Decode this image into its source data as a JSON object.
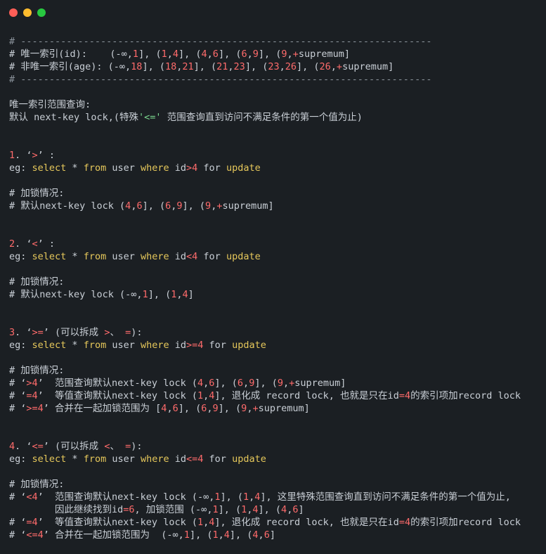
{
  "window": {
    "controls": [
      {
        "name": "close",
        "color": "#ff5f57"
      },
      {
        "name": "minimize",
        "color": "#febc2e"
      },
      {
        "name": "zoom",
        "color": "#28c840"
      }
    ]
  },
  "lines": [
    {
      "segs": [
        {
          "t": "# ------------------------------------------------------------------------",
          "c": "dim"
        }
      ]
    },
    {
      "segs": [
        {
          "t": "# 唯一索引(id):    (-∞,",
          "c": "cm"
        },
        {
          "t": "1",
          "c": "num"
        },
        {
          "t": "], (",
          "c": "cm"
        },
        {
          "t": "1",
          "c": "num"
        },
        {
          "t": ",",
          "c": "cm"
        },
        {
          "t": "4",
          "c": "num"
        },
        {
          "t": "], (",
          "c": "cm"
        },
        {
          "t": "4",
          "c": "num"
        },
        {
          "t": ",",
          "c": "cm"
        },
        {
          "t": "6",
          "c": "num"
        },
        {
          "t": "], (",
          "c": "cm"
        },
        {
          "t": "6",
          "c": "num"
        },
        {
          "t": ",",
          "c": "cm"
        },
        {
          "t": "9",
          "c": "num"
        },
        {
          "t": "], (",
          "c": "cm"
        },
        {
          "t": "9",
          "c": "num"
        },
        {
          "t": ",",
          "c": "cm"
        },
        {
          "t": "+",
          "c": "op"
        },
        {
          "t": "supremum]",
          "c": "cm"
        }
      ]
    },
    {
      "segs": [
        {
          "t": "# 非唯一索引(age): (-∞,",
          "c": "cm"
        },
        {
          "t": "18",
          "c": "num"
        },
        {
          "t": "], (",
          "c": "cm"
        },
        {
          "t": "18",
          "c": "num"
        },
        {
          "t": ",",
          "c": "cm"
        },
        {
          "t": "21",
          "c": "num"
        },
        {
          "t": "], (",
          "c": "cm"
        },
        {
          "t": "21",
          "c": "num"
        },
        {
          "t": ",",
          "c": "cm"
        },
        {
          "t": "23",
          "c": "num"
        },
        {
          "t": "], (",
          "c": "cm"
        },
        {
          "t": "23",
          "c": "num"
        },
        {
          "t": ",",
          "c": "cm"
        },
        {
          "t": "26",
          "c": "num"
        },
        {
          "t": "], (",
          "c": "cm"
        },
        {
          "t": "26",
          "c": "num"
        },
        {
          "t": ",",
          "c": "cm"
        },
        {
          "t": "+",
          "c": "op"
        },
        {
          "t": "supremum]",
          "c": "cm"
        }
      ]
    },
    {
      "segs": [
        {
          "t": "# ------------------------------------------------------------------------",
          "c": "dim"
        }
      ]
    },
    {
      "segs": []
    },
    {
      "segs": [
        {
          "t": "唯一索引范围查询:",
          "c": "cm"
        }
      ]
    },
    {
      "segs": [
        {
          "t": "默认 next-key lock,(特殊",
          "c": "cm"
        },
        {
          "t": "'<='",
          "c": "str"
        },
        {
          "t": " 范围查询直到访问不满足条件的第一个值为止)",
          "c": "cm"
        }
      ]
    },
    {
      "segs": []
    },
    {
      "segs": []
    },
    {
      "segs": [
        {
          "t": "1",
          "c": "num"
        },
        {
          "t": ". ‘",
          "c": "cm"
        },
        {
          "t": ">",
          "c": "op"
        },
        {
          "t": "’ :",
          "c": "cm"
        }
      ]
    },
    {
      "segs": [
        {
          "t": "eg: ",
          "c": "cm"
        },
        {
          "t": "select",
          "c": "kw"
        },
        {
          "t": " * ",
          "c": "cm"
        },
        {
          "t": "from",
          "c": "kw"
        },
        {
          "t": " user ",
          "c": "cm"
        },
        {
          "t": "where",
          "c": "kw"
        },
        {
          "t": " id",
          "c": "cm"
        },
        {
          "t": ">",
          "c": "op"
        },
        {
          "t": "4",
          "c": "num"
        },
        {
          "t": " for ",
          "c": "cm"
        },
        {
          "t": "update",
          "c": "kw"
        }
      ]
    },
    {
      "segs": []
    },
    {
      "segs": [
        {
          "t": "# 加锁情况:",
          "c": "cm"
        }
      ]
    },
    {
      "segs": [
        {
          "t": "# 默认next-key lock (",
          "c": "cm"
        },
        {
          "t": "4",
          "c": "num"
        },
        {
          "t": ",",
          "c": "cm"
        },
        {
          "t": "6",
          "c": "num"
        },
        {
          "t": "], (",
          "c": "cm"
        },
        {
          "t": "6",
          "c": "num"
        },
        {
          "t": ",",
          "c": "cm"
        },
        {
          "t": "9",
          "c": "num"
        },
        {
          "t": "], (",
          "c": "cm"
        },
        {
          "t": "9",
          "c": "num"
        },
        {
          "t": ",",
          "c": "cm"
        },
        {
          "t": "+",
          "c": "op"
        },
        {
          "t": "supremum]",
          "c": "cm"
        }
      ]
    },
    {
      "segs": []
    },
    {
      "segs": []
    },
    {
      "segs": [
        {
          "t": "2",
          "c": "num"
        },
        {
          "t": ". ‘",
          "c": "cm"
        },
        {
          "t": "<",
          "c": "op"
        },
        {
          "t": "’ :",
          "c": "cm"
        }
      ]
    },
    {
      "segs": [
        {
          "t": "eg: ",
          "c": "cm"
        },
        {
          "t": "select",
          "c": "kw"
        },
        {
          "t": " * ",
          "c": "cm"
        },
        {
          "t": "from",
          "c": "kw"
        },
        {
          "t": " user ",
          "c": "cm"
        },
        {
          "t": "where",
          "c": "kw"
        },
        {
          "t": " id",
          "c": "cm"
        },
        {
          "t": "<",
          "c": "op"
        },
        {
          "t": "4",
          "c": "num"
        },
        {
          "t": " for ",
          "c": "cm"
        },
        {
          "t": "update",
          "c": "kw"
        }
      ]
    },
    {
      "segs": []
    },
    {
      "segs": [
        {
          "t": "# 加锁情况:",
          "c": "cm"
        }
      ]
    },
    {
      "segs": [
        {
          "t": "# 默认next-key lock (-∞,",
          "c": "cm"
        },
        {
          "t": "1",
          "c": "num"
        },
        {
          "t": "], (",
          "c": "cm"
        },
        {
          "t": "1",
          "c": "num"
        },
        {
          "t": ",",
          "c": "cm"
        },
        {
          "t": "4",
          "c": "num"
        },
        {
          "t": "]",
          "c": "cm"
        }
      ]
    },
    {
      "segs": []
    },
    {
      "segs": []
    },
    {
      "segs": [
        {
          "t": "3",
          "c": "num"
        },
        {
          "t": ". ‘",
          "c": "cm"
        },
        {
          "t": ">=",
          "c": "op"
        },
        {
          "t": "’ (可以拆成 ",
          "c": "cm"
        },
        {
          "t": ">",
          "c": "op"
        },
        {
          "t": "、 ",
          "c": "cm"
        },
        {
          "t": "=",
          "c": "op"
        },
        {
          "t": "):",
          "c": "cm"
        }
      ]
    },
    {
      "segs": [
        {
          "t": "eg: ",
          "c": "cm"
        },
        {
          "t": "select",
          "c": "kw"
        },
        {
          "t": " * ",
          "c": "cm"
        },
        {
          "t": "from",
          "c": "kw"
        },
        {
          "t": " user ",
          "c": "cm"
        },
        {
          "t": "where",
          "c": "kw"
        },
        {
          "t": " id",
          "c": "cm"
        },
        {
          "t": ">=",
          "c": "op"
        },
        {
          "t": "4",
          "c": "num"
        },
        {
          "t": " for ",
          "c": "cm"
        },
        {
          "t": "update",
          "c": "kw"
        }
      ]
    },
    {
      "segs": []
    },
    {
      "segs": [
        {
          "t": "# 加锁情况:",
          "c": "cm"
        }
      ]
    },
    {
      "segs": [
        {
          "t": "# ‘",
          "c": "cm"
        },
        {
          "t": ">4",
          "c": "op"
        },
        {
          "t": "’  范围查询默认next-key lock (",
          "c": "cm"
        },
        {
          "t": "4",
          "c": "num"
        },
        {
          "t": ",",
          "c": "cm"
        },
        {
          "t": "6",
          "c": "num"
        },
        {
          "t": "], (",
          "c": "cm"
        },
        {
          "t": "6",
          "c": "num"
        },
        {
          "t": ",",
          "c": "cm"
        },
        {
          "t": "9",
          "c": "num"
        },
        {
          "t": "], (",
          "c": "cm"
        },
        {
          "t": "9",
          "c": "num"
        },
        {
          "t": ",",
          "c": "cm"
        },
        {
          "t": "+",
          "c": "op"
        },
        {
          "t": "supremum]",
          "c": "cm"
        }
      ]
    },
    {
      "segs": [
        {
          "t": "# ‘",
          "c": "cm"
        },
        {
          "t": "=4",
          "c": "op"
        },
        {
          "t": "’  等值查询默认next-key lock (",
          "c": "cm"
        },
        {
          "t": "1",
          "c": "num"
        },
        {
          "t": ",",
          "c": "cm"
        },
        {
          "t": "4",
          "c": "num"
        },
        {
          "t": "], 退化成 record lock, 也就是只在id",
          "c": "cm"
        },
        {
          "t": "=4",
          "c": "op"
        },
        {
          "t": "的索引项加record lock",
          "c": "cm"
        }
      ]
    },
    {
      "segs": [
        {
          "t": "# ‘",
          "c": "cm"
        },
        {
          "t": ">=4",
          "c": "op"
        },
        {
          "t": "’ 合并在一起加锁范围为 [",
          "c": "cm"
        },
        {
          "t": "4",
          "c": "num"
        },
        {
          "t": ",",
          "c": "cm"
        },
        {
          "t": "6",
          "c": "num"
        },
        {
          "t": "], (",
          "c": "cm"
        },
        {
          "t": "6",
          "c": "num"
        },
        {
          "t": ",",
          "c": "cm"
        },
        {
          "t": "9",
          "c": "num"
        },
        {
          "t": "], (",
          "c": "cm"
        },
        {
          "t": "9",
          "c": "num"
        },
        {
          "t": ",",
          "c": "cm"
        },
        {
          "t": "+",
          "c": "op"
        },
        {
          "t": "supremum]",
          "c": "cm"
        }
      ]
    },
    {
      "segs": []
    },
    {
      "segs": []
    },
    {
      "segs": [
        {
          "t": "4",
          "c": "num"
        },
        {
          "t": ". ‘",
          "c": "cm"
        },
        {
          "t": "<=",
          "c": "op"
        },
        {
          "t": "’ (可以拆成 ",
          "c": "cm"
        },
        {
          "t": "<",
          "c": "op"
        },
        {
          "t": "、 ",
          "c": "cm"
        },
        {
          "t": "=",
          "c": "op"
        },
        {
          "t": "):",
          "c": "cm"
        }
      ]
    },
    {
      "segs": [
        {
          "t": "eg: ",
          "c": "cm"
        },
        {
          "t": "select",
          "c": "kw"
        },
        {
          "t": " * ",
          "c": "cm"
        },
        {
          "t": "from",
          "c": "kw"
        },
        {
          "t": " user ",
          "c": "cm"
        },
        {
          "t": "where",
          "c": "kw"
        },
        {
          "t": " id",
          "c": "cm"
        },
        {
          "t": "<=",
          "c": "op"
        },
        {
          "t": "4",
          "c": "num"
        },
        {
          "t": " for ",
          "c": "cm"
        },
        {
          "t": "update",
          "c": "kw"
        }
      ]
    },
    {
      "segs": []
    },
    {
      "segs": [
        {
          "t": "# 加锁情况:",
          "c": "cm"
        }
      ]
    },
    {
      "segs": [
        {
          "t": "# ‘",
          "c": "cm"
        },
        {
          "t": "<4",
          "c": "op"
        },
        {
          "t": "’  范围查询默认next-key lock (-∞,",
          "c": "cm"
        },
        {
          "t": "1",
          "c": "num"
        },
        {
          "t": "], (",
          "c": "cm"
        },
        {
          "t": "1",
          "c": "num"
        },
        {
          "t": ",",
          "c": "cm"
        },
        {
          "t": "4",
          "c": "num"
        },
        {
          "t": "], 这里特殊范围查询直到访问不满足条件的第一个值为止,",
          "c": "cm"
        }
      ]
    },
    {
      "segs": [
        {
          "t": "        因此继续找到id",
          "c": "cm"
        },
        {
          "t": "=6",
          "c": "op"
        },
        {
          "t": ", 加锁范围 (-∞,",
          "c": "cm"
        },
        {
          "t": "1",
          "c": "num"
        },
        {
          "t": "], (",
          "c": "cm"
        },
        {
          "t": "1",
          "c": "num"
        },
        {
          "t": ",",
          "c": "cm"
        },
        {
          "t": "4",
          "c": "num"
        },
        {
          "t": "], (",
          "c": "cm"
        },
        {
          "t": "4",
          "c": "num"
        },
        {
          "t": ",",
          "c": "cm"
        },
        {
          "t": "6",
          "c": "num"
        },
        {
          "t": "]",
          "c": "cm"
        }
      ]
    },
    {
      "segs": [
        {
          "t": "# ‘",
          "c": "cm"
        },
        {
          "t": "=4",
          "c": "op"
        },
        {
          "t": "’  等值查询默认next-key lock (",
          "c": "cm"
        },
        {
          "t": "1",
          "c": "num"
        },
        {
          "t": ",",
          "c": "cm"
        },
        {
          "t": "4",
          "c": "num"
        },
        {
          "t": "], 退化成 record lock, 也就是只在id",
          "c": "cm"
        },
        {
          "t": "=4",
          "c": "op"
        },
        {
          "t": "的索引项加record lock",
          "c": "cm"
        }
      ]
    },
    {
      "segs": [
        {
          "t": "# ‘",
          "c": "cm"
        },
        {
          "t": "<=4",
          "c": "op"
        },
        {
          "t": "’ 合并在一起加锁范围为  (-∞,",
          "c": "cm"
        },
        {
          "t": "1",
          "c": "num"
        },
        {
          "t": "], (",
          "c": "cm"
        },
        {
          "t": "1",
          "c": "num"
        },
        {
          "t": ",",
          "c": "cm"
        },
        {
          "t": "4",
          "c": "num"
        },
        {
          "t": "], (",
          "c": "cm"
        },
        {
          "t": "4",
          "c": "num"
        },
        {
          "t": ",",
          "c": "cm"
        },
        {
          "t": "6",
          "c": "num"
        },
        {
          "t": "]",
          "c": "cm"
        }
      ]
    }
  ]
}
